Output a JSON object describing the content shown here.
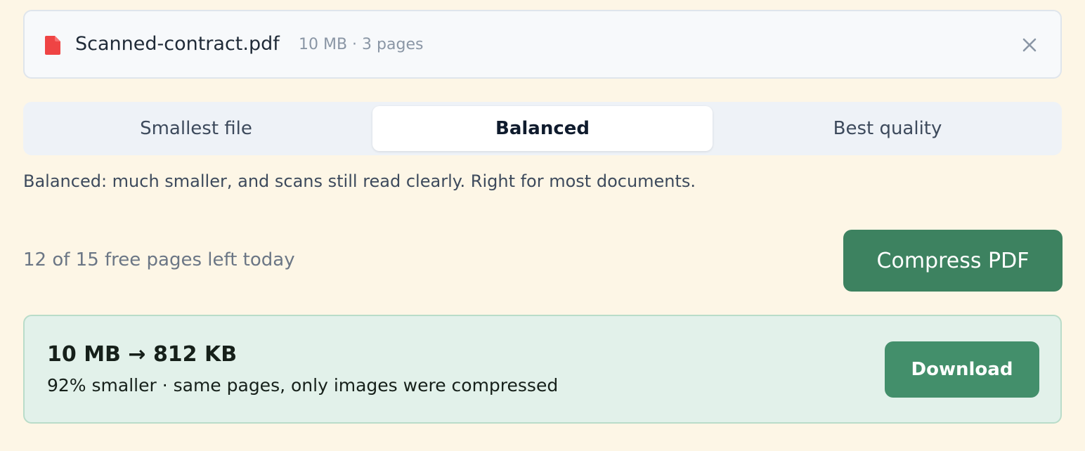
{
  "file": {
    "name": "Scanned-contract.pdf",
    "meta": "10 MB · 3 pages",
    "icon": "pdf-file-icon",
    "icon_color": "#ef4444",
    "close_icon": "close-icon"
  },
  "quality_options": [
    {
      "label": "Smallest file",
      "selected": false
    },
    {
      "label": "Balanced",
      "selected": true
    },
    {
      "label": "Best quality",
      "selected": false
    }
  ],
  "description": "Balanced: much smaller, and scans still read clearly. Right for most documents.",
  "quota_text": "12 of 15 free pages left today",
  "compress_button": "Compress PDF",
  "result": {
    "title": "10 MB → 812 KB",
    "subtitle": "92% smaller · same pages, only images were compressed",
    "download_button": "Download"
  },
  "colors": {
    "page_bg": "#fdf6e6",
    "accent": "#3d8260",
    "result_bg": "#e2f1ea",
    "pdf_red": "#ef4444"
  }
}
